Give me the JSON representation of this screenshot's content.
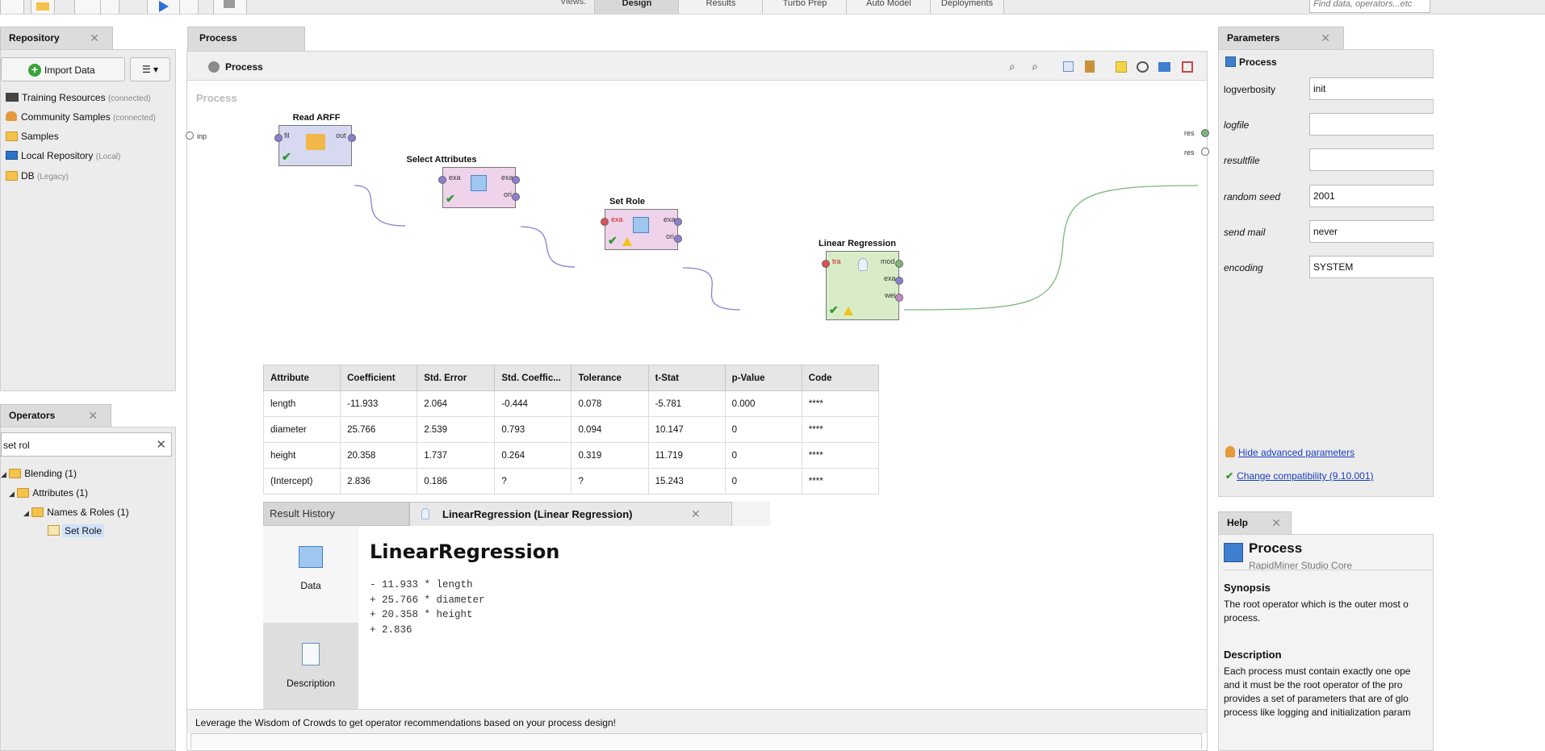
{
  "toolbar": {
    "views_label": "Views:",
    "view_tabs": [
      "Design",
      "Results",
      "Turbo Prep",
      "Auto Model",
      "Deployments"
    ],
    "search_placeholder": "Find data, operators...etc"
  },
  "repository": {
    "tab_label": "Repository",
    "import_button": "Import Data",
    "items": [
      {
        "label": "Training Resources",
        "note": "(connected)",
        "icon": "graduation-cap-icon"
      },
      {
        "label": "Community Samples",
        "note": "(connected)",
        "icon": "community-icon"
      },
      {
        "label": "Samples",
        "note": "",
        "icon": "folder-icon"
      },
      {
        "label": "Local Repository",
        "note": "(Local)",
        "icon": "monitor-icon"
      },
      {
        "label": "DB",
        "note": "(Legacy)",
        "icon": "database-icon"
      }
    ]
  },
  "operators": {
    "tab_label": "Operators",
    "search_value": "set rol",
    "tree": [
      {
        "label": "Blending (1)"
      },
      {
        "label": "Attributes (1)"
      },
      {
        "label": "Names & Roles (1)"
      },
      {
        "label": "Set Role"
      }
    ]
  },
  "process": {
    "tab_label": "Process",
    "breadcrumb": "Process",
    "canvas_label": "Process",
    "inp_port": "inp",
    "res_ports": [
      "res",
      "res"
    ],
    "operators": [
      {
        "title": "Read ARFF",
        "ports_in": [
          "fil"
        ],
        "ports_out": [
          "out"
        ]
      },
      {
        "title": "Select Attributes",
        "ports_in": [
          "exa"
        ],
        "ports_out": [
          "exa",
          "ori"
        ]
      },
      {
        "title": "Set Role",
        "ports_in": [
          "exa"
        ],
        "ports_out": [
          "exa",
          "ori"
        ]
      },
      {
        "title": "Linear Regression",
        "ports_in": [
          "tra"
        ],
        "ports_out": [
          "mod",
          "exa",
          "wei"
        ]
      }
    ],
    "status_message": "Leverage the Wisdom of Crowds to get operator recommendations based on your process design!"
  },
  "results_table": {
    "headers": [
      "Attribute",
      "Coefficient",
      "Std. Error",
      "Std. Coeffic...",
      "Tolerance",
      "t-Stat",
      "p-Value",
      "Code"
    ],
    "rows": [
      [
        "length",
        "-11.933",
        "2.064",
        "-0.444",
        "0.078",
        "-5.781",
        "0.000",
        "****"
      ],
      [
        "diameter",
        "25.766",
        "2.539",
        "0.793",
        "0.094",
        "10.147",
        "0",
        "****"
      ],
      [
        "height",
        "20.358",
        "1.737",
        "0.264",
        "0.319",
        "11.719",
        "0",
        "****"
      ],
      [
        "(Intercept)",
        "2.836",
        "0.186",
        "?",
        "?",
        "15.243",
        "0",
        "****"
      ]
    ]
  },
  "result_history": {
    "tab_label": "Result History",
    "active_tab_label": "LinearRegression (Linear Regression)",
    "side_buttons": [
      "Data",
      "Description"
    ],
    "model_title": "LinearRegression",
    "equation": [
      "- 11.933 * length",
      "+ 25.766 * diameter",
      "+ 20.358 * height",
      "+ 2.836"
    ]
  },
  "parameters": {
    "tab_label": "Parameters",
    "header": "Process",
    "rows": [
      {
        "label": "logverbosity",
        "value": "init"
      },
      {
        "label": "logfile",
        "value": ""
      },
      {
        "label": "resultfile",
        "value": ""
      },
      {
        "label": "random seed",
        "value": "2001"
      },
      {
        "label": "send mail",
        "value": "never"
      },
      {
        "label": "encoding",
        "value": "SYSTEM"
      }
    ],
    "hide_advanced_link": "Hide advanced parameters",
    "compat_link": "Change compatibility (9.10.001)"
  },
  "help": {
    "tab_label": "Help",
    "title": "Process",
    "subtitle": "RapidMiner Studio Core",
    "synopsis_heading": "Synopsis",
    "synopsis_text": "The root operator which is the outer most o process.",
    "description_heading": "Description",
    "description_text": "Each process must contain exactly one ope and it must be the root operator of the pro provides a set of parameters that are of glo process like logging and initialization param"
  },
  "colors": {
    "panel_bg": "#ececec",
    "green_link": "#7ab87a",
    "purple_link": "#8a7fd0",
    "op_read": "#d6d9ef",
    "op_select": "#efd3ea",
    "op_role": "#efd3ea",
    "op_linreg": "#d8ecc8"
  }
}
